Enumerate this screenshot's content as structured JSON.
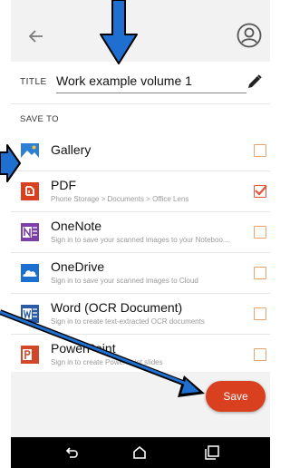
{
  "header": {
    "back_icon": "arrow-left-icon",
    "account_icon": "account-circle-icon"
  },
  "title_field": {
    "label": "TITLE",
    "value": "Work example volume 1",
    "edit_icon": "pencil-icon"
  },
  "save_to": {
    "label": "SAVE TO",
    "items": [
      {
        "name": "Gallery",
        "subtitle": "",
        "icon": "gallery-icon",
        "checked": false
      },
      {
        "name": "PDF",
        "subtitle": "Phone Storage > Documents > Office Lens",
        "icon": "pdf-icon",
        "checked": true
      },
      {
        "name": "OneNote",
        "subtitle": "Sign in to save your scanned images to your Noteboo...",
        "icon": "onenote-icon",
        "checked": false
      },
      {
        "name": "OneDrive",
        "subtitle": "Sign in to save your scanned images to Cloud",
        "icon": "onedrive-icon",
        "checked": false
      },
      {
        "name": "Word (OCR Document)",
        "subtitle": "Sign in to create text-extracted OCR documents",
        "icon": "word-icon",
        "checked": false
      },
      {
        "name": "PowerPoint",
        "subtitle": "Sign in to create PowerPoint slides",
        "icon": "powerpoint-icon",
        "checked": false
      }
    ]
  },
  "actions": {
    "save_label": "Save"
  },
  "colors": {
    "accent": "#d9401f",
    "checkbox_border": "#e8a36f",
    "arrow_fill": "#1f6fd1"
  },
  "navbar": {
    "back_icon": "nav-back-icon",
    "home_icon": "nav-home-icon",
    "recent_icon": "nav-recents-icon"
  }
}
